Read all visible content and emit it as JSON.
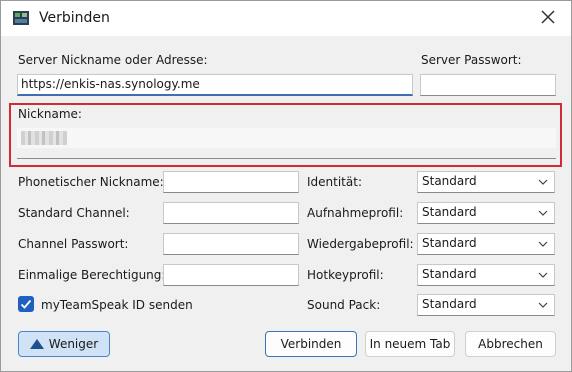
{
  "window": {
    "title": "Verbinden"
  },
  "server": {
    "address_label": "Server Nickname oder Adresse:",
    "address_value": "https://enkis-nas.synology.me",
    "password_label": "Server Passwort:",
    "password_value": ""
  },
  "nickname": {
    "label": "Nickname:"
  },
  "fields": {
    "phonetic_label": "Phonetischer Nickname:",
    "channel_label": "Standard Channel:",
    "channel_password_label": "Channel Passwort:",
    "onetime_label": "Einmalige Berechtigung:",
    "myteamspeak_label": "myTeamSpeak ID senden",
    "myteamspeak_checked": true
  },
  "profiles": {
    "identity_label": "Identität:",
    "identity_value": "Standard",
    "capture_label": "Aufnahmeprofil:",
    "capture_value": "Standard",
    "playback_label": "Wiedergabeprofil:",
    "playback_value": "Standard",
    "hotkey_label": "Hotkeyprofil:",
    "hotkey_value": "Standard",
    "soundpack_label": "Sound Pack:",
    "soundpack_value": "Standard"
  },
  "buttons": {
    "less": "Weniger",
    "connect": "Verbinden",
    "new_tab": "In neuem Tab",
    "cancel": "Abbrechen"
  },
  "colors": {
    "accent": "#1f5fbf",
    "highlight_border": "#d12b36",
    "less_button_bg": "#cfe2f6"
  }
}
